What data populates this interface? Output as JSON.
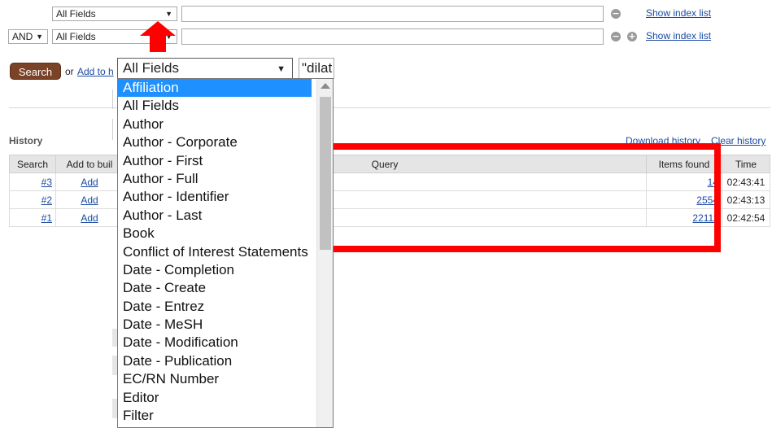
{
  "builder": {
    "row1": {
      "field": "All Fields",
      "show_index": "Show index list"
    },
    "row2": {
      "bool": "AND",
      "field": "All Fields",
      "show_index": "Show index list"
    },
    "minus_glyph": "−",
    "plus_glyph": "+"
  },
  "search_row": {
    "search_button": "Search",
    "or_text": "or",
    "add_link": "Add to h",
    "field_select": "All Fields",
    "query_value": "\"dilat"
  },
  "history": {
    "title": "History",
    "download": "Download history",
    "clear": "Clear history",
    "columns": [
      "Search",
      "Add to buil",
      "Query",
      "Items found",
      "Time"
    ],
    "rows": [
      {
        "search": "#3",
        "add": "Add",
        "items": "14",
        "time": "02:43:41"
      },
      {
        "search": "#2",
        "add": "Add",
        "items": "2554",
        "time": "02:43:13"
      },
      {
        "search": "#1",
        "add": "Add",
        "items": "22111",
        "time": "02:42:54"
      }
    ]
  },
  "dropdown": {
    "items": [
      "Affiliation",
      "All Fields",
      "Author",
      "Author - Corporate",
      "Author - First",
      "Author - Full",
      "Author - Identifier",
      "Author - Last",
      "Book",
      "Conflict of Interest Statements",
      "Date - Completion",
      "Date - Create",
      "Date - Entrez",
      "Date - MeSH",
      "Date - Modification",
      "Date - Publication",
      "EC/RN Number",
      "Editor",
      "Filter"
    ],
    "highlighted_index": 0
  },
  "annotation_colors": {
    "red": "#ff0000",
    "highlight": "#1e90ff",
    "button": "#7a4226"
  }
}
